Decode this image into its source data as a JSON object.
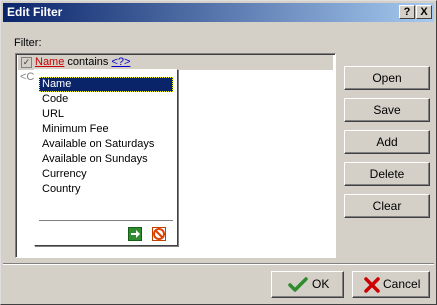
{
  "window": {
    "title": "Edit Filter",
    "help_label": "?",
    "close_label": "X"
  },
  "filter": {
    "label": "Filter:",
    "condition": {
      "field": "Name",
      "operator": "contains",
      "value": "<?>"
    },
    "add_row_text": "<C"
  },
  "popup": {
    "selected": "Name",
    "items": [
      "Name",
      "Code",
      "URL",
      "Minimum Fee",
      "Available on Saturdays",
      "Available on Sundays",
      "Currency",
      "Country"
    ]
  },
  "side_buttons": {
    "open": "Open",
    "save": "Save",
    "add": "Add",
    "delete": "Delete",
    "clear": "Clear"
  },
  "footer": {
    "ok": "OK",
    "cancel": "Cancel"
  },
  "colors": {
    "titlebar_start": "#0a246a",
    "titlebar_end": "#a6caf0",
    "field_link": "#cc0000",
    "value_link": "#0000cc",
    "ok_check": "#2e8b2e",
    "cancel_x": "#cc0000"
  }
}
